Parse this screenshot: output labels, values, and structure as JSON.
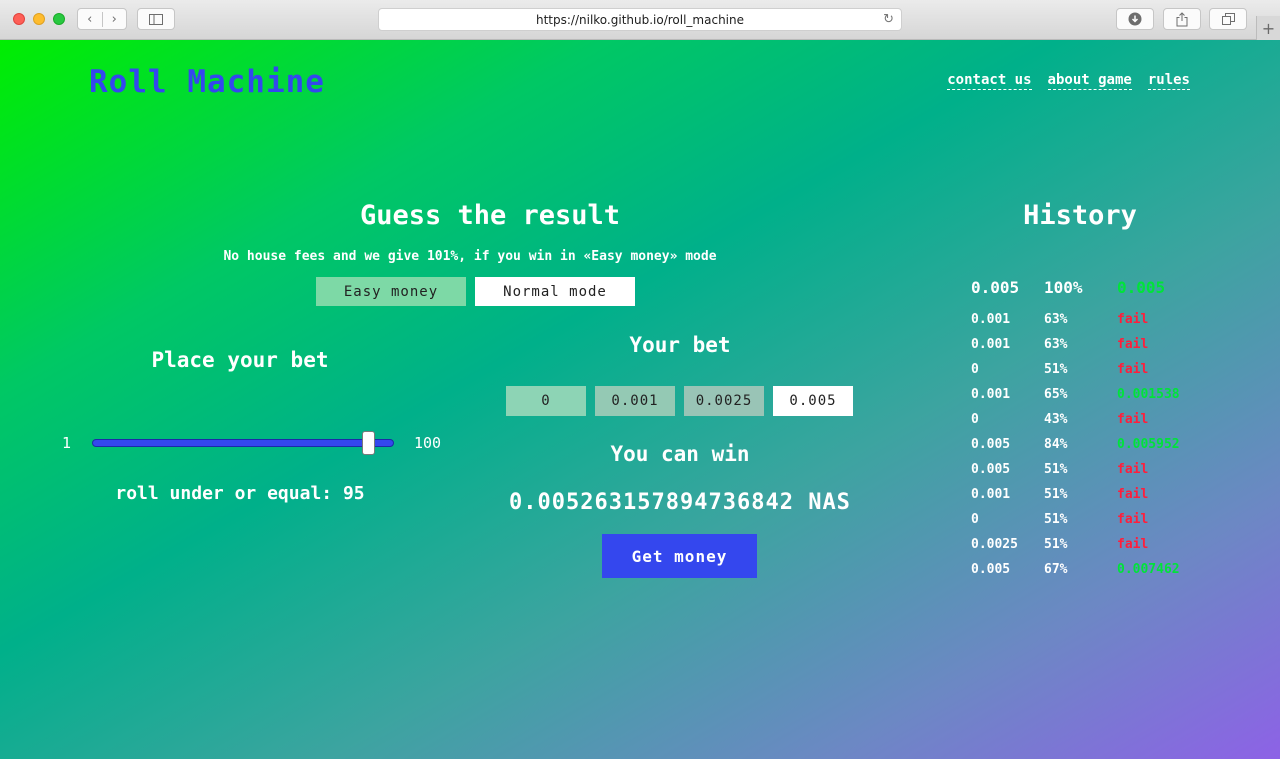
{
  "browser": {
    "url": "https://nilko.github.io/roll_machine"
  },
  "header": {
    "logo": "Roll Machine",
    "nav": [
      "contact us",
      "about game",
      "rules"
    ]
  },
  "game": {
    "title": "Guess the result",
    "subtitle": "No house fees and we give 101%, if you win in «Easy money» mode",
    "modes": [
      {
        "label": "Easy money",
        "active": true
      },
      {
        "label": "Normal mode",
        "active": false
      }
    ],
    "place_bet": {
      "title": "Place your bet",
      "slider_min": "1",
      "slider_max": "100",
      "slider_value": 95,
      "roll_text": "roll under or equal: 95"
    },
    "your_bet": {
      "title": "Your bet",
      "options": [
        "0",
        "0.001",
        "0.0025",
        "0.005"
      ],
      "selected": "0.005"
    },
    "win": {
      "title": "You can win",
      "amount": "0.005263157894736842 NAS"
    },
    "action_label": "Get money"
  },
  "history": {
    "title": "History",
    "rows": [
      {
        "bet": "0.005",
        "chance": "100%",
        "result": "0.005",
        "win": true
      },
      {
        "bet": "0.001",
        "chance": "63%",
        "result": "fail",
        "win": false
      },
      {
        "bet": "0.001",
        "chance": "63%",
        "result": "fail",
        "win": false
      },
      {
        "bet": "0",
        "chance": "51%",
        "result": "fail",
        "win": false
      },
      {
        "bet": "0.001",
        "chance": "65%",
        "result": "0.001538",
        "win": true
      },
      {
        "bet": "0",
        "chance": "43%",
        "result": "fail",
        "win": false
      },
      {
        "bet": "0.005",
        "chance": "84%",
        "result": "0.005952",
        "win": true
      },
      {
        "bet": "0.005",
        "chance": "51%",
        "result": "fail",
        "win": false
      },
      {
        "bet": "0.001",
        "chance": "51%",
        "result": "fail",
        "win": false
      },
      {
        "bet": "0",
        "chance": "51%",
        "result": "fail",
        "win": false
      },
      {
        "bet": "0.0025",
        "chance": "51%",
        "result": "fail",
        "win": false
      },
      {
        "bet": "0.005",
        "chance": "67%",
        "result": "0.007462",
        "win": true
      }
    ]
  },
  "colors": {
    "accent": "#3447ee",
    "win": "#00e33a",
    "fail": "#ff1e3c"
  }
}
